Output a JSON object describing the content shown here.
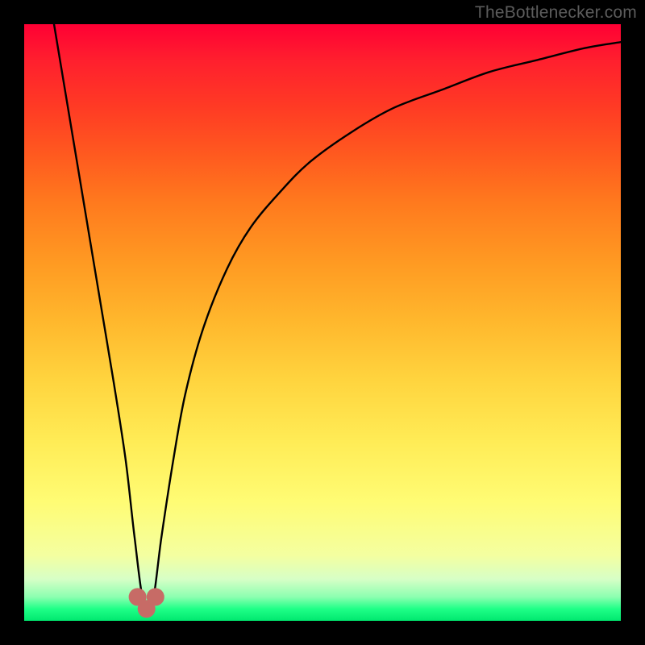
{
  "watermark": {
    "text": "TheBottlenecker.com"
  },
  "colors": {
    "frame": "#000000",
    "curve_stroke": "#000000",
    "marker_fill": "#c76b66",
    "gradient_stops": [
      "#ff0034",
      "#ff1f2e",
      "#ff3b24",
      "#ff5a1f",
      "#ff7a1e",
      "#ff9a22",
      "#ffb82d",
      "#ffd53f",
      "#ffec56",
      "#fffc74",
      "#f4ffa0",
      "#d7ffc6",
      "#8cffb0",
      "#1fff87",
      "#00e86f"
    ]
  },
  "chart_data": {
    "type": "line",
    "title": "",
    "xlabel": "",
    "ylabel": "",
    "xlim": [
      0,
      100
    ],
    "ylim": [
      0,
      100
    ],
    "grid": false,
    "legend": false,
    "series": [
      {
        "name": "bottleneck-curve",
        "x": [
          5,
          7,
          9,
          11,
          13,
          15,
          17,
          18.5,
          20,
          21.5,
          23,
          25,
          27,
          30,
          34,
          38,
          43,
          48,
          55,
          62,
          70,
          78,
          86,
          94,
          100
        ],
        "y": [
          100,
          88,
          76,
          64,
          52,
          40,
          27,
          14,
          3,
          3,
          14,
          27,
          38,
          49,
          59,
          66,
          72,
          77,
          82,
          86,
          89,
          92,
          94,
          96,
          97
        ]
      }
    ],
    "markers": [
      {
        "name": "min-left",
        "x": 19.0,
        "y": 4.0
      },
      {
        "name": "min-bottom",
        "x": 20.5,
        "y": 2.0
      },
      {
        "name": "min-right",
        "x": 22.0,
        "y": 4.0
      }
    ],
    "note": "x/y in percent of plot area; y measured upward from bottom (0=bottom, 100=top)."
  }
}
